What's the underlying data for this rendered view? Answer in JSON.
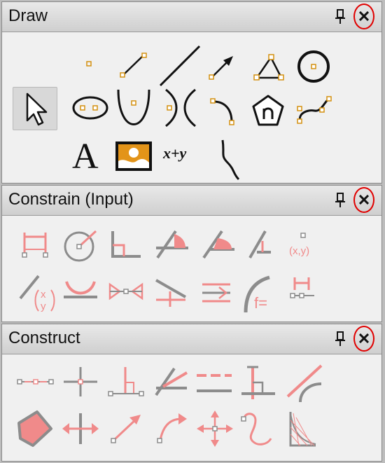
{
  "panels": {
    "draw": {
      "title": "Draw"
    },
    "constrain": {
      "title": "Constrain (Input)"
    },
    "construct": {
      "title": "Construct"
    }
  },
  "draw_tools": {
    "text_symbol": "A",
    "formula_symbol": "x+y"
  },
  "constrain_tools": {
    "point_coords_label": "(x,y)",
    "coord_x": "x",
    "coord_y": "y",
    "formula_label": "f="
  },
  "colors": {
    "close_highlight": "#e00000",
    "handle_orange": "#d4900f",
    "constraint_pink": "#f08a8a",
    "constraint_gray": "#8c8c8c"
  }
}
